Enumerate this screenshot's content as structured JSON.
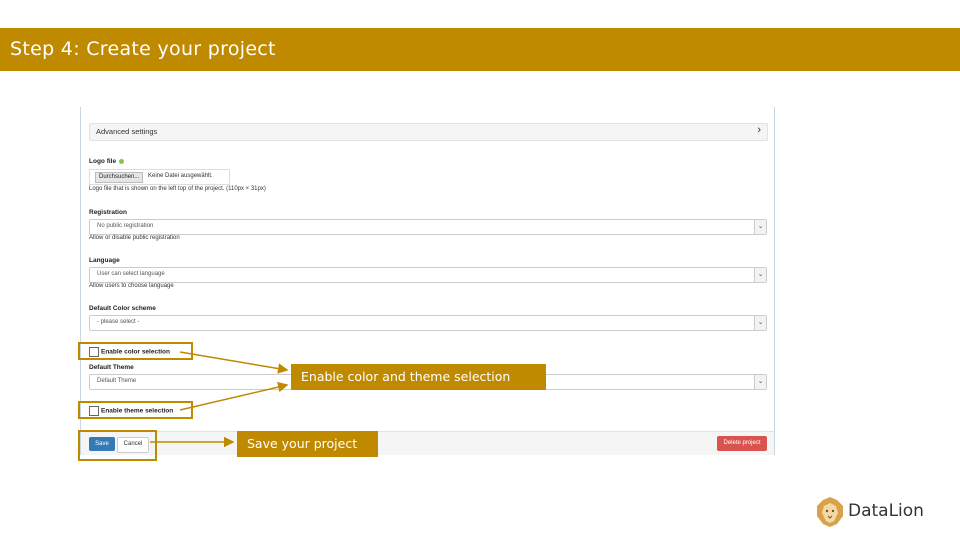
{
  "slide": {
    "title": "Step 4: Create your project"
  },
  "advanced": {
    "label": "Advanced settings",
    "chevron": "›"
  },
  "logo_file": {
    "label": "Logo file",
    "browse_button": "Durchsuchen...",
    "file_status": "Keine Datei ausgewählt.",
    "help": "Logo file that is shown on the left top of the project. (110px × 31px)"
  },
  "registration": {
    "label": "Registration",
    "value": "No public registration",
    "help": "Allow or disable public registration"
  },
  "language": {
    "label": "Language",
    "value": "User can select language",
    "help": "Allow users to choose language"
  },
  "color_scheme": {
    "label": "Default Color scheme",
    "value": "- please select -"
  },
  "enable_color": {
    "label": "Enable color selection",
    "checked": false
  },
  "theme": {
    "label": "Default Theme",
    "value": "Default Theme"
  },
  "enable_theme": {
    "label": "Enable theme selection",
    "checked": false
  },
  "footer": {
    "save": "Save",
    "cancel": "Cancel",
    "delete": "Delete project"
  },
  "callouts": {
    "theme_selection": "Enable color and theme selection",
    "save_project": "Save your project"
  },
  "brand": {
    "name": "DataLion",
    "accent": "#bf8900"
  },
  "icons": {
    "select_caret": "chevron-down-icon",
    "advanced": "chevron-right-icon",
    "logo": "lion-icon"
  }
}
